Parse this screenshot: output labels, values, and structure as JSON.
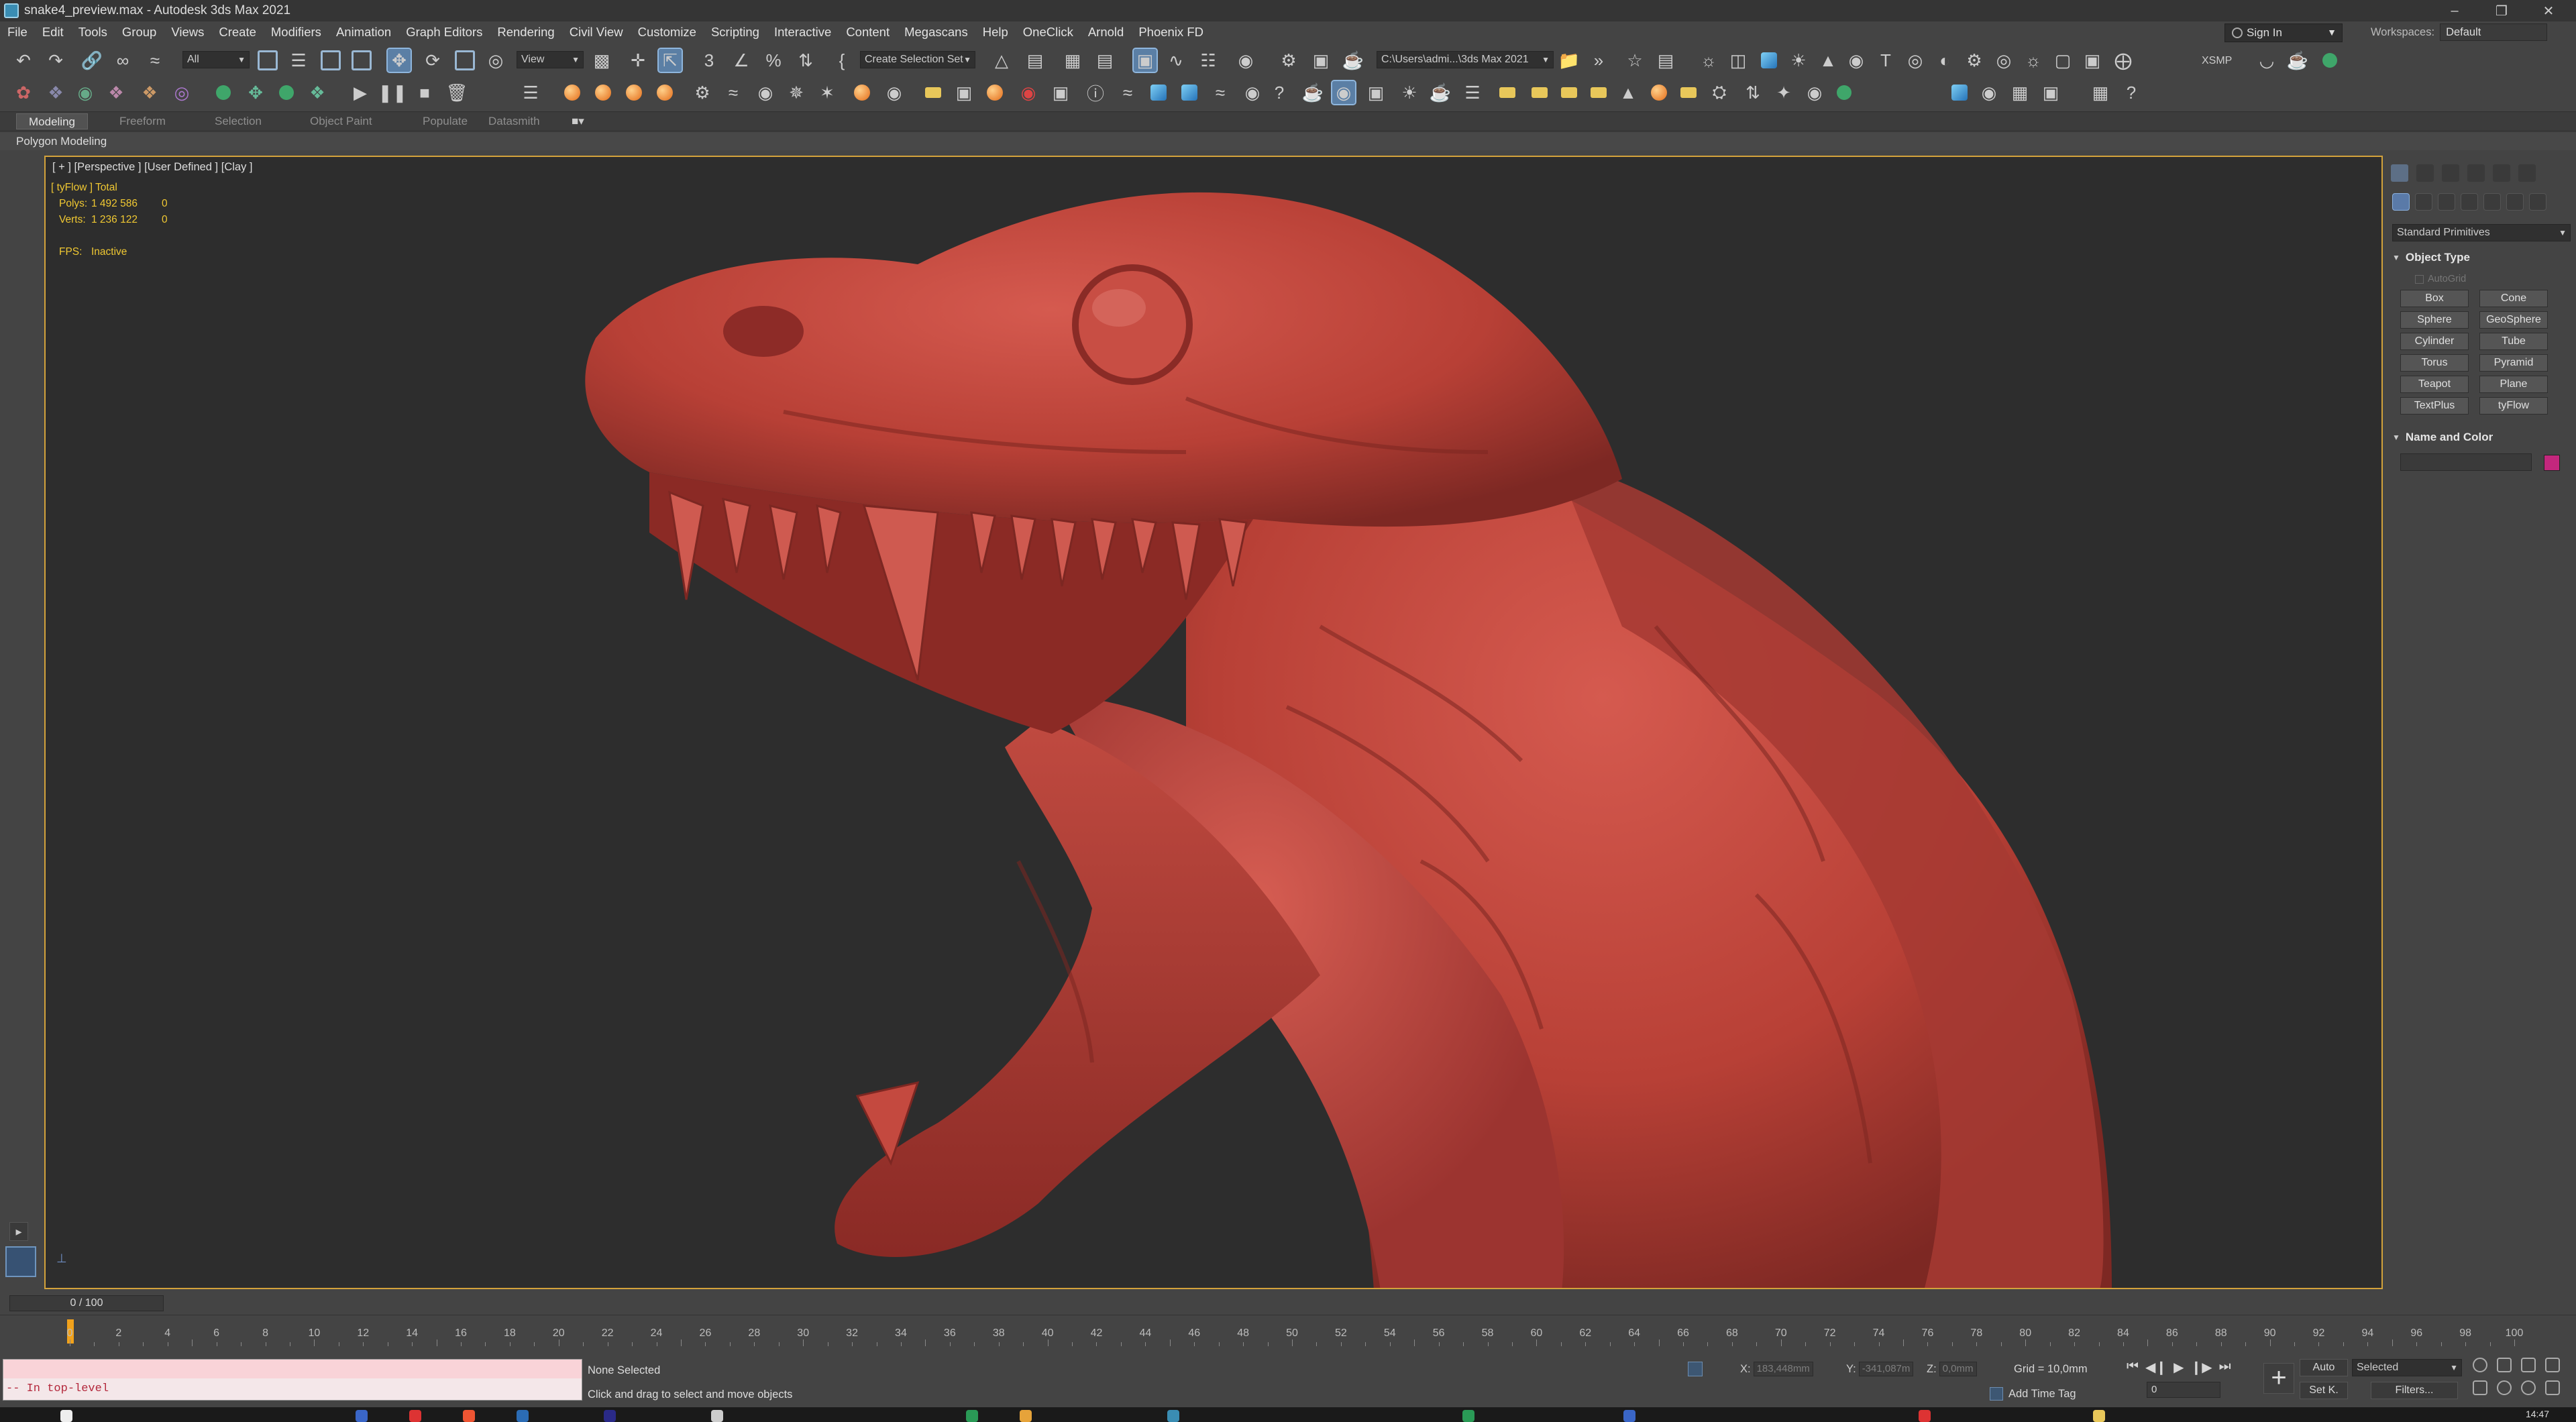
{
  "titlebar": {
    "title": "snake4_preview.max - Autodesk 3ds Max 2021"
  },
  "menu": [
    "File",
    "Edit",
    "Tools",
    "Group",
    "Views",
    "Create",
    "Modifiers",
    "Animation",
    "Graph Editors",
    "Rendering",
    "Civil View",
    "Customize",
    "Scripting",
    "Interactive",
    "Content",
    "Megascans",
    "Help",
    "OneClick",
    "Arnold",
    "Phoenix FD"
  ],
  "account": {
    "sign_in": "Sign In",
    "workspaces_label": "Workspaces:",
    "workspace": "Default"
  },
  "toolbar": {
    "selection_filter": "All",
    "ref_coord": "View",
    "named_selection": "Create Selection Set",
    "project_path": "C:\\Users\\admi...\\3ds Max 2021",
    "xsmp_label": "XSMP"
  },
  "ribbon": {
    "tabs": [
      "Modeling",
      "Freeform",
      "Selection",
      "Object Paint",
      "Populate",
      "Datasmith"
    ],
    "active": "Modeling",
    "sub": "Polygon Modeling"
  },
  "viewport": {
    "label": "[ + ] [Perspective ] [User Defined ] [Clay ]",
    "stats_header": "[ tyFlow ] Total",
    "polys_label": "Polys:",
    "polys_total": "1 492 586",
    "polys_sel": "0",
    "verts_label": "Verts:",
    "verts_total": "1 236 122",
    "verts_sel": "0",
    "fps_label": "FPS:",
    "fps_value": "Inactive",
    "model_color": "#c0463e",
    "bg_color": "#2d2d2d",
    "border_color": "#d3a23b"
  },
  "command_panel": {
    "category": "Standard Primitives",
    "object_type": "Object Type",
    "autogrid": "AutoGrid",
    "primitives": [
      "Box",
      "Cone",
      "Sphere",
      "GeoSphere",
      "Cylinder",
      "Tube",
      "Torus",
      "Pyramid",
      "Teapot",
      "Plane",
      "TextPlus",
      "tyFlow"
    ],
    "name_and_color": "Name and Color",
    "swatch_color": "#c3277d"
  },
  "timeline": {
    "range": "0 / 100",
    "ticks": [
      "0",
      "2",
      "4",
      "6",
      "8",
      "10",
      "12",
      "14",
      "16",
      "18",
      "20",
      "22",
      "24",
      "26",
      "28",
      "30",
      "32",
      "34",
      "36",
      "38",
      "40",
      "42",
      "44",
      "46",
      "48",
      "50",
      "52",
      "54",
      "56",
      "58",
      "60",
      "62",
      "64",
      "66",
      "68",
      "70",
      "72",
      "74",
      "76",
      "78",
      "80",
      "82",
      "84",
      "86",
      "88",
      "90",
      "92",
      "94",
      "96",
      "98",
      "100"
    ]
  },
  "status": {
    "listener_text": "-- In top-level",
    "selection": "None Selected",
    "hint": "Click and drag to select and move objects",
    "x_label": "X:",
    "x_val": "183,448mm",
    "y_label": "Y:",
    "y_val": "-341,087m",
    "z_label": "Z:",
    "z_val": "0,0mm",
    "grid": "Grid = 10,0mm",
    "add_time_tag": "Add Time Tag",
    "auto": "Auto",
    "selected": "Selected",
    "set_k": "Set K.",
    "filters": "Filters...",
    "frame": "0"
  },
  "taskbar": {
    "clock": "14:47"
  }
}
